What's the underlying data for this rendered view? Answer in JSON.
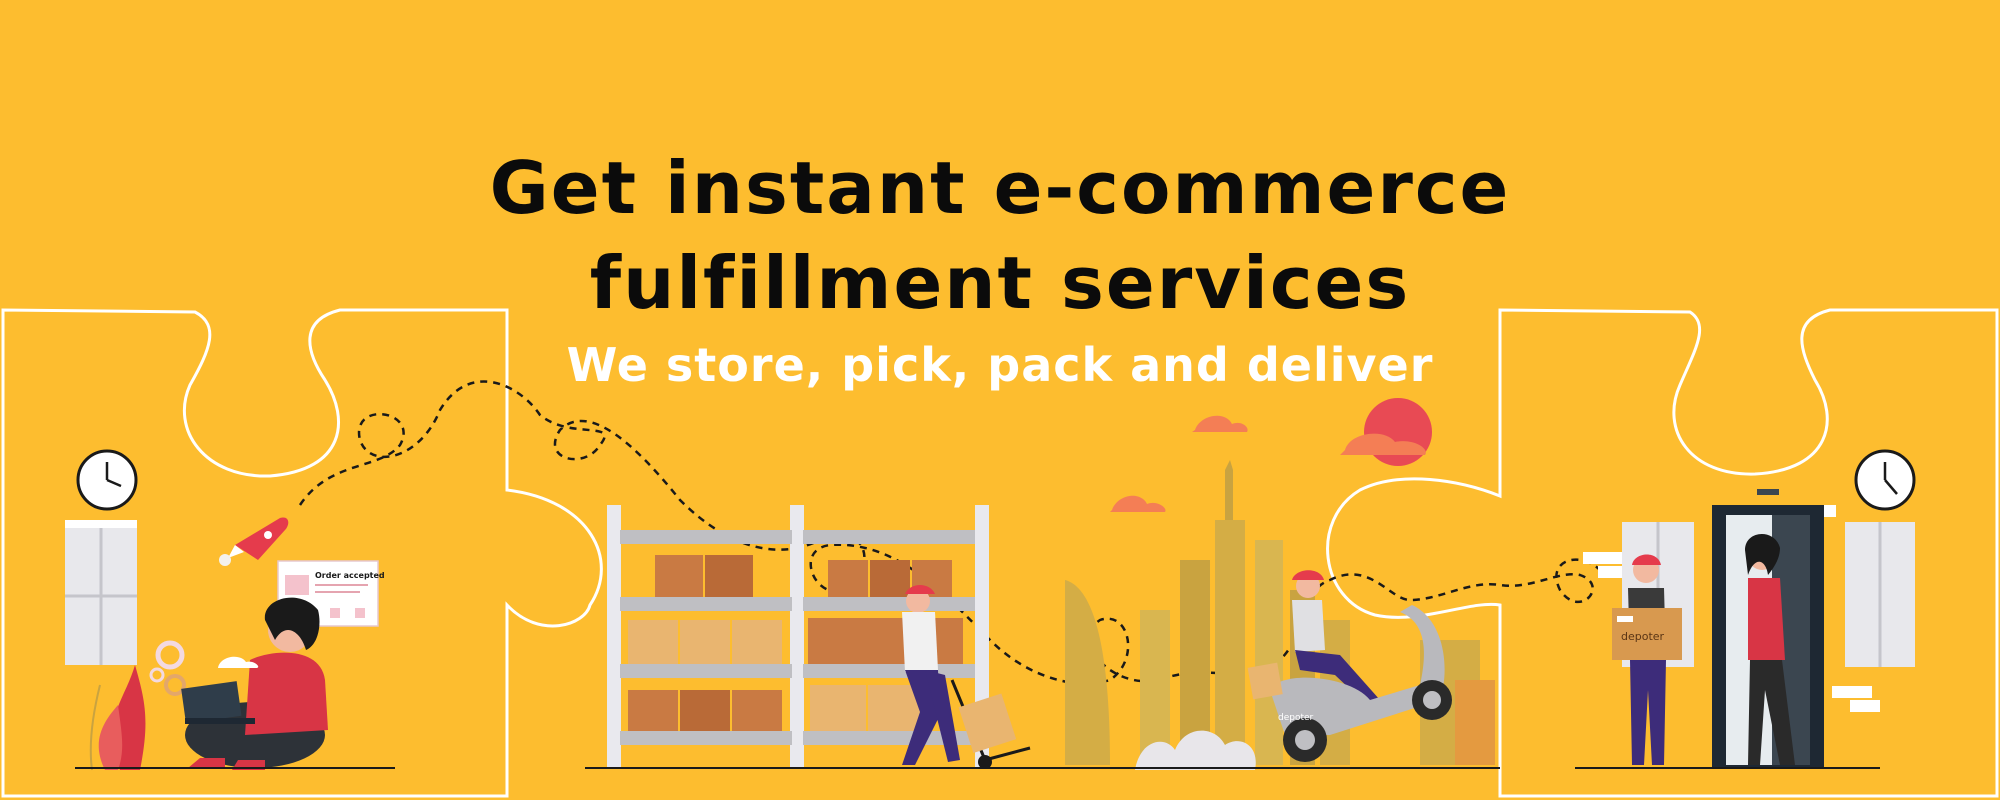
{
  "banner": {
    "title_line1": "Get instant e-commerce",
    "title_line2": "fulfillment services",
    "subtitle": "We store, pick, pack and deliver"
  },
  "illustration": {
    "order_card_label": "Order accepted",
    "box_brand": "depoter",
    "scooter_brand": "depoter"
  },
  "colors": {
    "background": "#fdbd2f",
    "title": "#0b0b0b",
    "subtitle": "#ffffff",
    "accent_red": "#e53b4c",
    "box_brown": "#c97a43",
    "shelf_grey": "#bfbfc3"
  },
  "icons": [
    "clock-icon",
    "window-icon",
    "rocket-icon",
    "laptop-icon",
    "gear-icon",
    "cloud-icon",
    "sun-icon",
    "scooter-icon",
    "hand-truck-icon",
    "door-icon"
  ]
}
